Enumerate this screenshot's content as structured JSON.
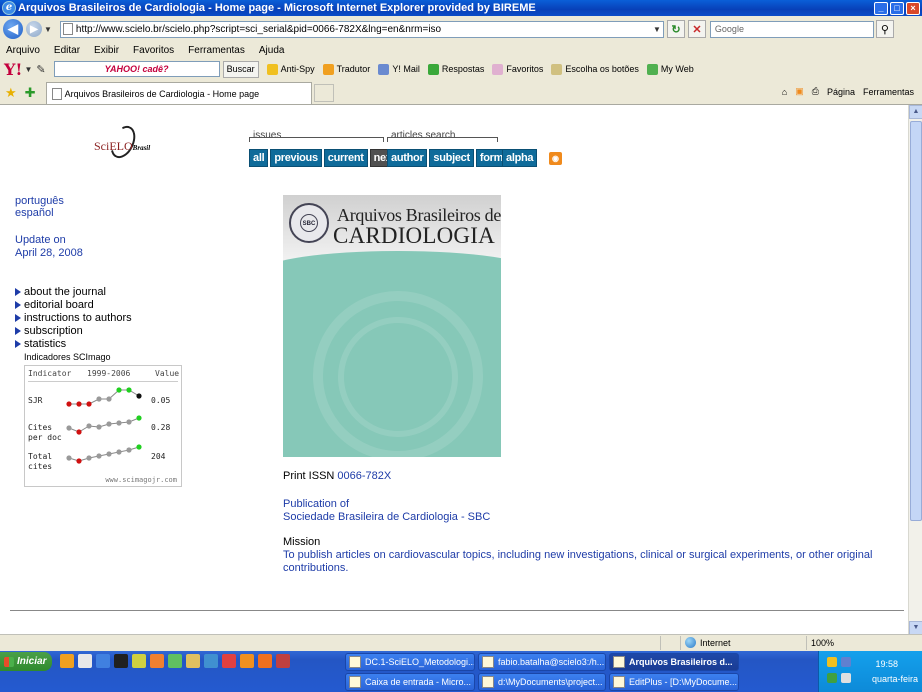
{
  "window": {
    "title": "Arquivos Brasileiros de Cardiologia - Home page - Microsoft Internet Explorer provided by BIREME",
    "min": "_",
    "max": "□",
    "close": "×"
  },
  "address": {
    "url": "http://www.scielo.br/scielo.php?script=sci_serial&pid=0066-782X&lng=en&nrm=iso",
    "search_placeholder": "Google"
  },
  "menu": [
    "Arquivo",
    "Editar",
    "Exibir",
    "Favoritos",
    "Ferramentas",
    "Ajuda"
  ],
  "yahoo_toolbar": {
    "logo": "Y!",
    "search_text": "YAHOO! cadê?",
    "search_button": "Buscar",
    "items": [
      "Anti-Spy",
      "Tradutor",
      "Y! Mail",
      "Respostas",
      "Favoritos",
      "Escolha os botões",
      "My Web"
    ]
  },
  "tabs": {
    "active_tab": "Arquivos Brasileiros de Cardiologia - Home page",
    "tools": [
      "Página",
      "Ferramentas"
    ]
  },
  "page": {
    "logo": {
      "main": "SciELO",
      "sub": "Brasil"
    },
    "groups": {
      "issues": "issues",
      "articles_search": "articles search"
    },
    "issue_buttons": [
      "all",
      "previous",
      "current",
      "next"
    ],
    "search_buttons": [
      "author",
      "subject",
      "form"
    ],
    "alpha_button": "alpha",
    "rss": "RSS",
    "languages": [
      "português",
      "español"
    ],
    "update": {
      "line1": "Update on",
      "line2": "April 28, 2008"
    },
    "menu_links": [
      "about the journal",
      "editorial board",
      "instructions to authors",
      "subscription",
      "statistics"
    ],
    "scimago": {
      "title": "Indicadores SCImago",
      "header": {
        "indicator": "Indicator",
        "years": "1999-2006",
        "value": "Value"
      },
      "rows": [
        {
          "label1": "SJR",
          "label2": "",
          "value": "0.05"
        },
        {
          "label1": "Cites",
          "label2": "per doc",
          "value": "0.28"
        },
        {
          "label1": "Total",
          "label2": "cites",
          "value": "204"
        }
      ],
      "url": "www.scimagojr.com"
    },
    "cover": {
      "line1": "Arquivos Brasileiros de",
      "line2": "CARDIOLOGIA",
      "seal": "SBC"
    },
    "print_issn": {
      "label": "Print ISSN",
      "value": "0066-782X"
    },
    "publication": {
      "label": "Publication of",
      "value": "Sociedade Brasileira de Cardiologia - SBC"
    },
    "mission": {
      "label": "Mission",
      "text": "To publish articles on cardiovascular topics, including new investigations, clinical or surgical experiments, or other original contributions."
    }
  },
  "status": {
    "zone": "Internet",
    "zoom": "100%"
  },
  "taskbar": {
    "start": "Iniciar",
    "buttons": [
      "DC.1-SciELO_Metodologi...",
      "fabio.batalha@scielo3:/h...",
      "Arquivos Brasileiros d...",
      "Caixa de entrada - Micro...",
      "d:\\MyDocuments\\project...",
      "EditPlus - [D:\\MyDocume..."
    ],
    "clock": "19:58",
    "day": "quarta-feira"
  }
}
